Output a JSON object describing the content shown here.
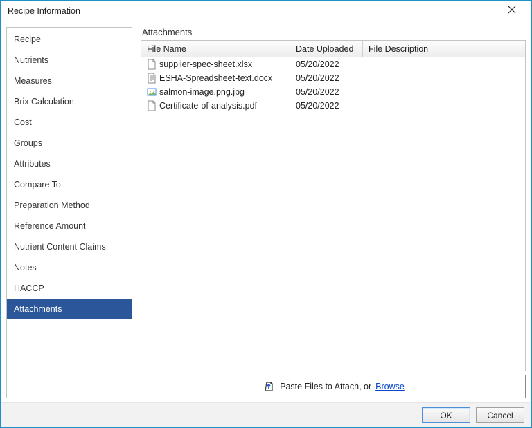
{
  "window": {
    "title": "Recipe Information"
  },
  "sidebar": {
    "items": [
      {
        "label": "Recipe"
      },
      {
        "label": "Nutrients"
      },
      {
        "label": "Measures"
      },
      {
        "label": "Brix Calculation"
      },
      {
        "label": "Cost"
      },
      {
        "label": "Groups"
      },
      {
        "label": "Attributes"
      },
      {
        "label": "Compare To"
      },
      {
        "label": "Preparation Method"
      },
      {
        "label": "Reference Amount"
      },
      {
        "label": "Nutrient Content Claims"
      },
      {
        "label": "Notes"
      },
      {
        "label": "HACCP"
      },
      {
        "label": "Attachments"
      }
    ],
    "selected_index": 13
  },
  "main": {
    "section_title": "Attachments",
    "columns": {
      "file_name": "File Name",
      "date_uploaded": "Date Uploaded",
      "file_description": "File Description"
    },
    "rows": [
      {
        "icon": "file",
        "name": "supplier-spec-sheet.xlsx",
        "date": "05/20/2022",
        "desc": ""
      },
      {
        "icon": "doc",
        "name": "ESHA-Spreadsheet-text.docx",
        "date": "05/20/2022",
        "desc": ""
      },
      {
        "icon": "image",
        "name": "salmon-image.png.jpg",
        "date": "05/20/2022",
        "desc": ""
      },
      {
        "icon": "file",
        "name": "Certificate-of-analysis.pdf",
        "date": "05/20/2022",
        "desc": ""
      }
    ],
    "dropzone": {
      "text": "Paste Files to Attach, or ",
      "link": "Browse"
    }
  },
  "footer": {
    "ok": "OK",
    "cancel": "Cancel"
  }
}
